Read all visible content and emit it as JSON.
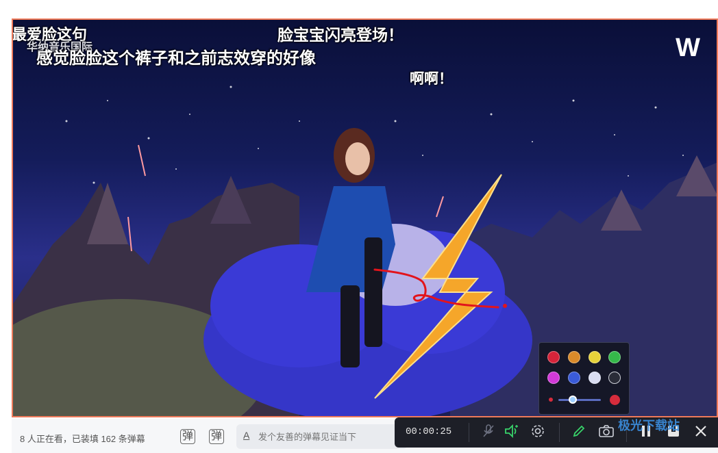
{
  "video": {
    "danmaku": [
      "最爱脸这句",
      "华纳音乐国际",
      "感觉脸脸这个裤子和之前志效穿的好像",
      "脸宝宝闪亮登场！",
      "啊啊！"
    ],
    "brand_logo": "W"
  },
  "palette": {
    "colors": [
      "#d6243a",
      "#d98a2a",
      "#e6d23a",
      "#35b84a",
      "#d23ad8",
      "#3a5bd8",
      "#d8dcf0",
      "#2a2c38"
    ],
    "pen_color": "#d62c3c"
  },
  "bottom_bar": {
    "viewers_text": "8 人正在看，已装填 162 条弹幕",
    "danmaku_icon": "弹",
    "danmaku_settings_icon": "弹",
    "input_placeholder": "发个友善的弹幕见证当下",
    "input_icon": "A"
  },
  "toolbar": {
    "timer": "00:00:25",
    "mic_icon": "mic-muted-icon",
    "speaker_icon": "speaker-icon",
    "settings_icon": "gear-icon",
    "pen_icon": "pen-icon",
    "camera_icon": "camera-icon",
    "pause_icon": "pause-icon",
    "stop_icon": "stop-icon",
    "close_icon": "close-icon"
  },
  "watermark": "极光下载站"
}
